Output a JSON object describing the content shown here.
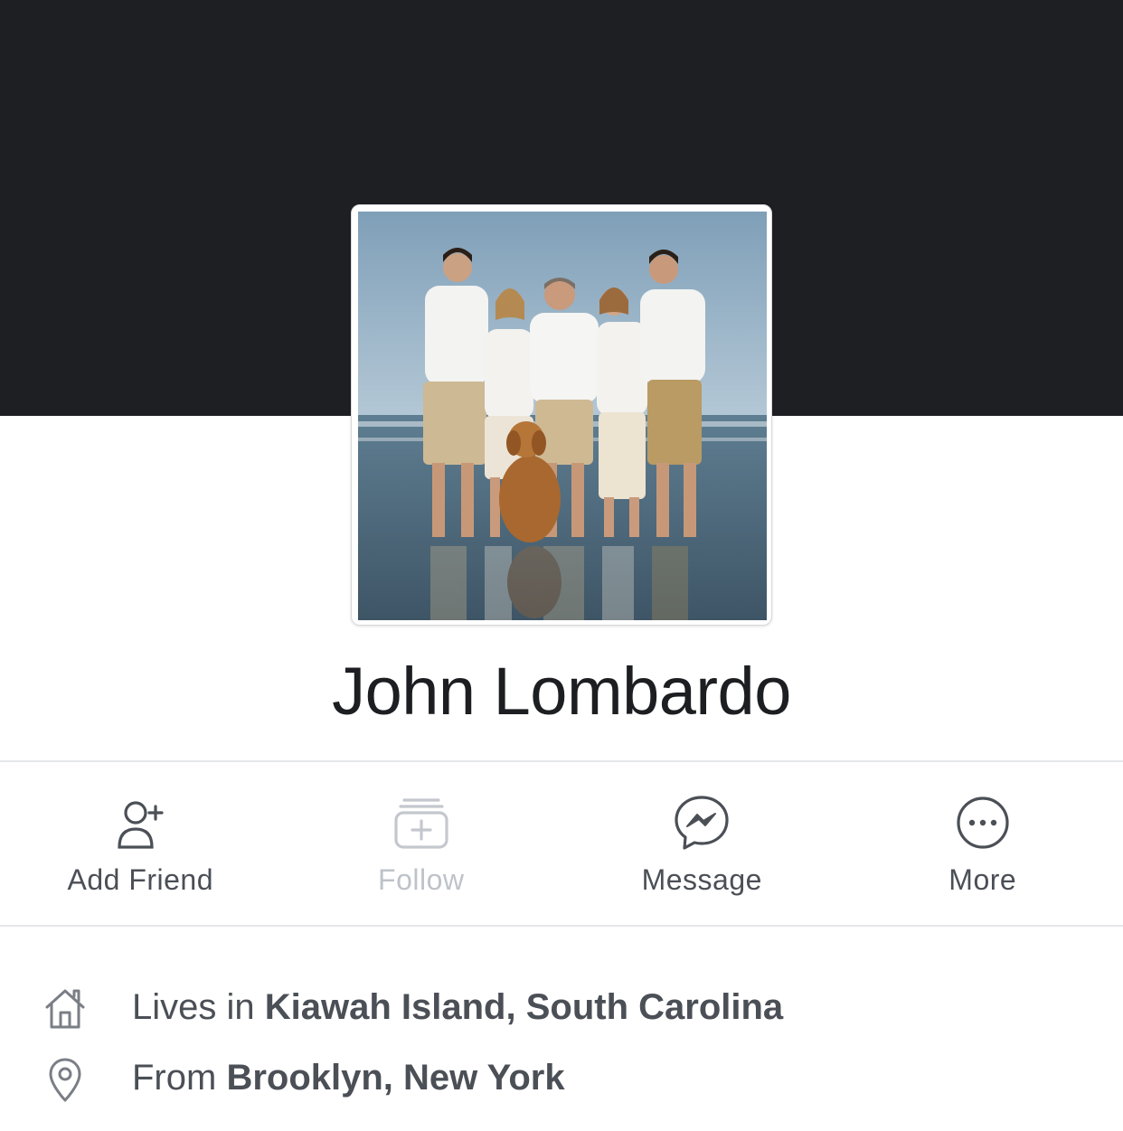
{
  "profile": {
    "name": "John Lombardo"
  },
  "actions": [
    {
      "label": "Add Friend",
      "icon": "add-friend-icon",
      "enabled": true
    },
    {
      "label": "Follow",
      "icon": "follow-icon",
      "enabled": false
    },
    {
      "label": "Message",
      "icon": "messenger-icon",
      "enabled": true
    },
    {
      "label": "More",
      "icon": "more-icon",
      "enabled": true
    }
  ],
  "info": {
    "lives": {
      "prefix": "Lives in ",
      "value": "Kiawah Island, South Carolina",
      "icon": "home-icon"
    },
    "from": {
      "prefix": "From ",
      "value": "Brooklyn, New York",
      "icon": "location-pin-icon"
    }
  },
  "colors": {
    "cover": "#1e1f23",
    "text_primary": "#1c1e21",
    "text_secondary": "#4b4f56",
    "text_disabled": "#bec3c9",
    "divider": "#e5e6ea"
  }
}
